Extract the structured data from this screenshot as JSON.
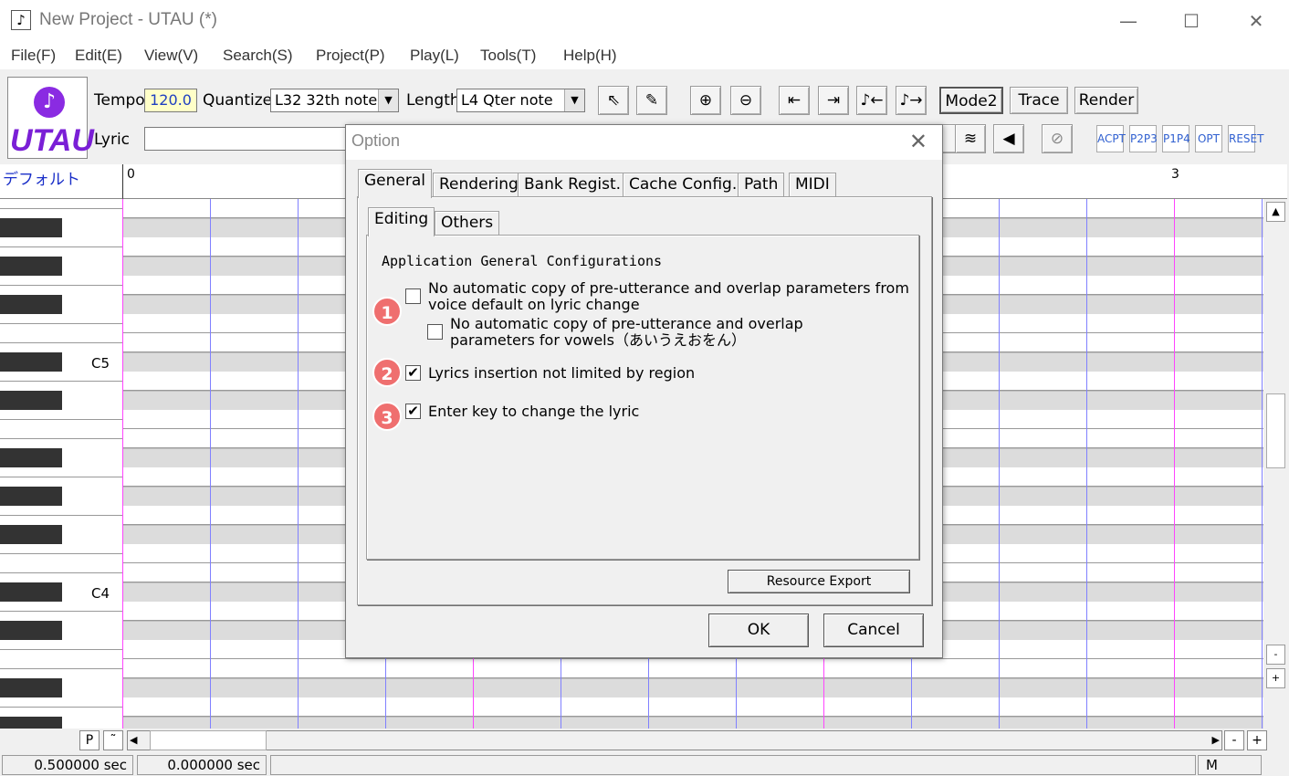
{
  "window": {
    "title": "New Project - UTAU (*)",
    "icon": "note-icon",
    "minimize": "—",
    "maximize": "☐",
    "close": "✕"
  },
  "menu": [
    "File(F)",
    "Edit(E)",
    "View(V)",
    "Search(S)",
    "Project(P)",
    "Play(L)",
    "Tools(T)",
    "Help(H)"
  ],
  "toolbar": {
    "logo_text": "UTAU",
    "tempo_label": "Tempo",
    "tempo_value": "120.0",
    "quantize_label": "Quantize",
    "quantize_value": "L32 32th note",
    "length_label": "Length",
    "length_value": "L4  Qter note",
    "lyric_label": "Lyric",
    "lyric_value": "",
    "mode_button": "Mode2",
    "trace_button": "Trace",
    "render_button": "Render",
    "icons": [
      "pointer-icon",
      "pencil-icon",
      "zoom-in-icon",
      "zoom-out-icon",
      "go-start-icon",
      "go-end-icon",
      "note-left-icon",
      "note-right-icon"
    ],
    "small_buttons": [
      "ACPT",
      "P2P3",
      "P1P4",
      "OPT",
      "RESET"
    ]
  },
  "track": {
    "name": "デフォルト",
    "ruler_marks": [
      "0",
      "3"
    ]
  },
  "piano": {
    "labels": [
      "C5",
      "C4"
    ]
  },
  "bottom": {
    "p_button": "P",
    "tilde_button": "˜",
    "minus_button": "-",
    "plus_button": "+",
    "vscroll_minus": "-",
    "vscroll_plus": "+"
  },
  "status": {
    "time1": "0.500000 sec",
    "time2": "0.000000 sec",
    "mode": "M"
  },
  "dialog": {
    "title": "Option",
    "tabs": [
      "General",
      "Rendering",
      "Bank Regist.",
      "Cache Config.",
      "Path",
      "MIDI"
    ],
    "subtabs": [
      "Editing",
      "Others"
    ],
    "section_heading": "Application General Configurations",
    "options": [
      {
        "badge": "1",
        "line1": "No automatic copy of pre-utterance and overlap parameters from",
        "line2": "voice default on lyric change",
        "checked": false
      },
      {
        "badge": "",
        "line1": "No automatic copy of pre-utterance and overlap",
        "line2": "parameters for vowels（あいうえおをん）",
        "checked": false
      },
      {
        "badge": "2",
        "line1": "Lyrics insertion not limited by region",
        "line2": "",
        "checked": true
      },
      {
        "badge": "3",
        "line1": "Enter key to change the lyric",
        "line2": "",
        "checked": true
      }
    ],
    "resource_export": "Resource Export",
    "ok": "OK",
    "cancel": "Cancel"
  }
}
